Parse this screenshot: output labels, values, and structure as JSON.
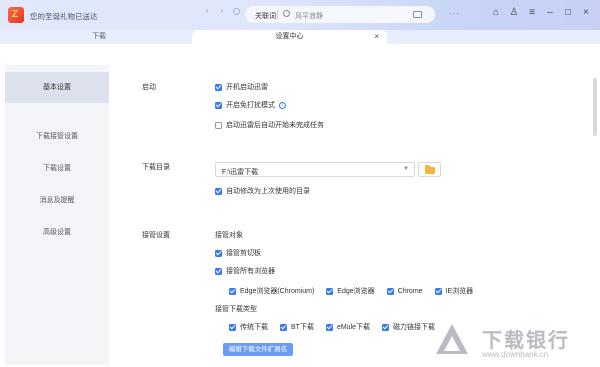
{
  "titlebar": {
    "promo_text": "您的圣诞礼物已送达",
    "search_keyword_tab": "关联词",
    "search_placeholder": "风平浪静",
    "window_icons": [
      "skin-icon",
      "shirt-icon",
      "settings-icon",
      "minimize-icon",
      "maximize-icon",
      "close-icon"
    ]
  },
  "tabs": {
    "download": "下载",
    "settings": "设置中心",
    "close_glyph": "×"
  },
  "sidebar": {
    "items": [
      {
        "label": "基本设置",
        "active": true
      },
      {
        "label": "下载接管设置",
        "active": false
      },
      {
        "label": "下载设置",
        "active": false
      },
      {
        "label": "消息及提醒",
        "active": false
      },
      {
        "label": "高级设置",
        "active": false
      }
    ]
  },
  "sections": {
    "startup": {
      "label": "启动",
      "options": [
        {
          "label": "开机启动迅雷",
          "checked": true
        },
        {
          "label": "开启免打扰模式",
          "checked": true
        },
        {
          "label": "启动迅雷后自动开始未完成任务",
          "checked": false
        }
      ]
    },
    "download_dir": {
      "label": "下载目录",
      "path": "F:\\迅雷下载",
      "auto_modify": {
        "label": "自动修改为上次使用的目录",
        "checked": true
      }
    },
    "takeover": {
      "label": "接管设置",
      "objects_title": "接管对象",
      "clipboard": {
        "label": "接管剪切板",
        "checked": true
      },
      "all_browsers": {
        "label": "接管所有浏览器",
        "checked": true
      },
      "browsers": [
        {
          "label": "Edge浏览器(Chromium)",
          "checked": true
        },
        {
          "label": "Edge浏览器",
          "checked": true
        },
        {
          "label": "Chrome",
          "checked": true
        },
        {
          "label": "IE浏览器",
          "checked": true
        }
      ],
      "types_title": "接管下载类型",
      "types": [
        {
          "label": "传统下载",
          "checked": true
        },
        {
          "label": "BT下载",
          "checked": true
        },
        {
          "label": "eMule下载",
          "checked": true
        },
        {
          "label": "磁力链接下载",
          "checked": true
        }
      ],
      "edit_button": "编辑下载文件扩展名"
    }
  },
  "watermark": {
    "title": "下载银行",
    "url": "www.downbank.cn"
  },
  "colors": {
    "accent": "#3a7af0",
    "sidebar_active": "#dde1ee"
  }
}
